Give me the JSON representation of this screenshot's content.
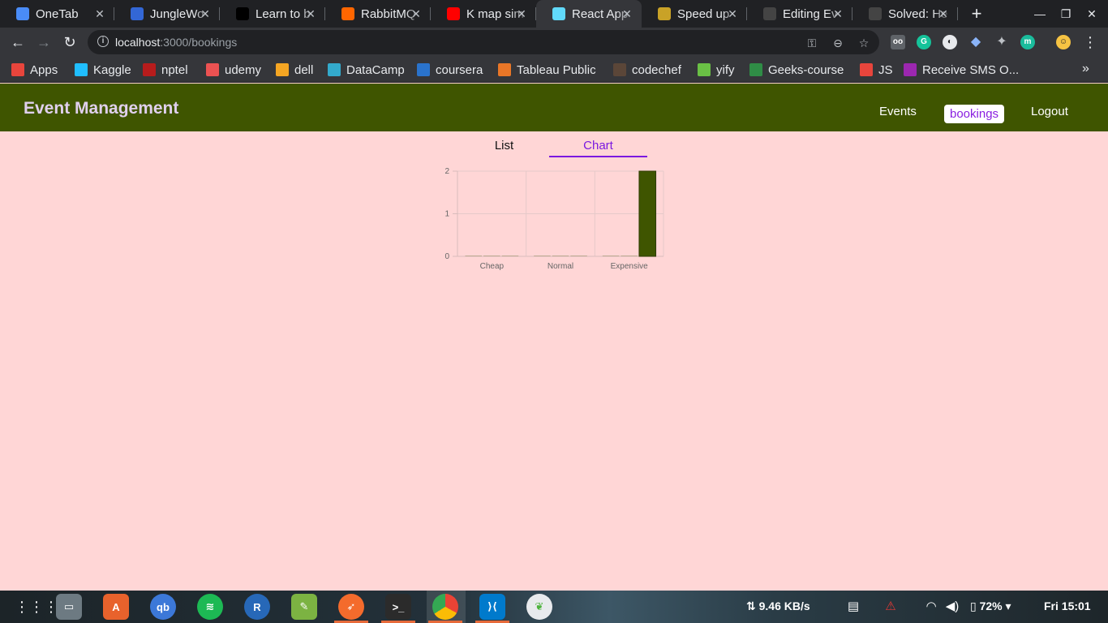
{
  "browser": {
    "tabs": [
      {
        "title": "OneTab",
        "icon": "gem-icon",
        "color": "#4a8cf7"
      },
      {
        "title": "JungleWo",
        "icon": "jungle-icon",
        "color": "#3367d6"
      },
      {
        "title": "Learn to b",
        "icon": "medium-icon",
        "color": "#000000"
      },
      {
        "title": "RabbitMQ",
        "icon": "rabbitmq-icon",
        "color": "#ff6600"
      },
      {
        "title": "K map sim",
        "icon": "youtube-icon",
        "color": "#ff0000"
      },
      {
        "title": "React App",
        "icon": "react-icon",
        "color": "#61dafb",
        "active": true
      },
      {
        "title": "Speed up",
        "icon": "wizard-icon",
        "color": "#c9a227"
      },
      {
        "title": "Editing Ev",
        "icon": "github-icon",
        "color": "#444444"
      },
      {
        "title": "Solved: He",
        "icon": "github-icon",
        "color": "#444444"
      }
    ],
    "url_host": "localhost",
    "url_path": ":3000/bookings",
    "bookmarks": [
      {
        "label": "Apps",
        "icon": "apps-grid-icon",
        "color": "#e8453c"
      },
      {
        "label": "Kaggle",
        "icon": "kaggle-icon",
        "color": "#20beff"
      },
      {
        "label": "nptel",
        "icon": "nptel-icon",
        "color": "#b71c1c"
      },
      {
        "label": "udemy",
        "icon": "udemy-icon",
        "color": "#ec5252"
      },
      {
        "label": "dell",
        "icon": "dell-icon",
        "color": "#f5a623"
      },
      {
        "label": "DataCamp",
        "icon": "datacamp-icon",
        "color": "#33aacc"
      },
      {
        "label": "coursera",
        "icon": "coursera-icon",
        "color": "#2a73cc"
      },
      {
        "label": "Tableau Public",
        "icon": "tableau-icon",
        "color": "#e97627"
      },
      {
        "label": "codechef",
        "icon": "codechef-icon",
        "color": "#5b4638"
      },
      {
        "label": "yify",
        "icon": "yify-icon",
        "color": "#6ac045"
      },
      {
        "label": "Geeks-course",
        "icon": "geeks-icon",
        "color": "#2f8d46"
      },
      {
        "label": "JS",
        "icon": "js-icon",
        "color": "#e8453c"
      },
      {
        "label": "Receive SMS O...",
        "icon": "sms-icon",
        "color": "#9c27b0"
      }
    ]
  },
  "app": {
    "brand": "Event Management",
    "nav": {
      "events": "Events",
      "bookings": "bookings",
      "logout": "Logout"
    },
    "tabs": {
      "list": "List",
      "chart": "Chart"
    }
  },
  "chart_data": {
    "type": "bar",
    "categories": [
      "Cheap",
      "Normal",
      "Expensive"
    ],
    "series": [
      {
        "values": [
          0,
          0,
          0
        ]
      },
      {
        "values": [
          0,
          0,
          0
        ]
      },
      {
        "values": [
          0,
          0,
          2
        ]
      }
    ],
    "ylim": [
      0,
      2
    ],
    "yticks": [
      "0",
      "1",
      "2"
    ],
    "bar_color": "#3f5500",
    "grid": true
  },
  "taskbar": {
    "net_speed": "9.46 KB/s",
    "battery": "72%",
    "clock": "Fri 15:01"
  }
}
